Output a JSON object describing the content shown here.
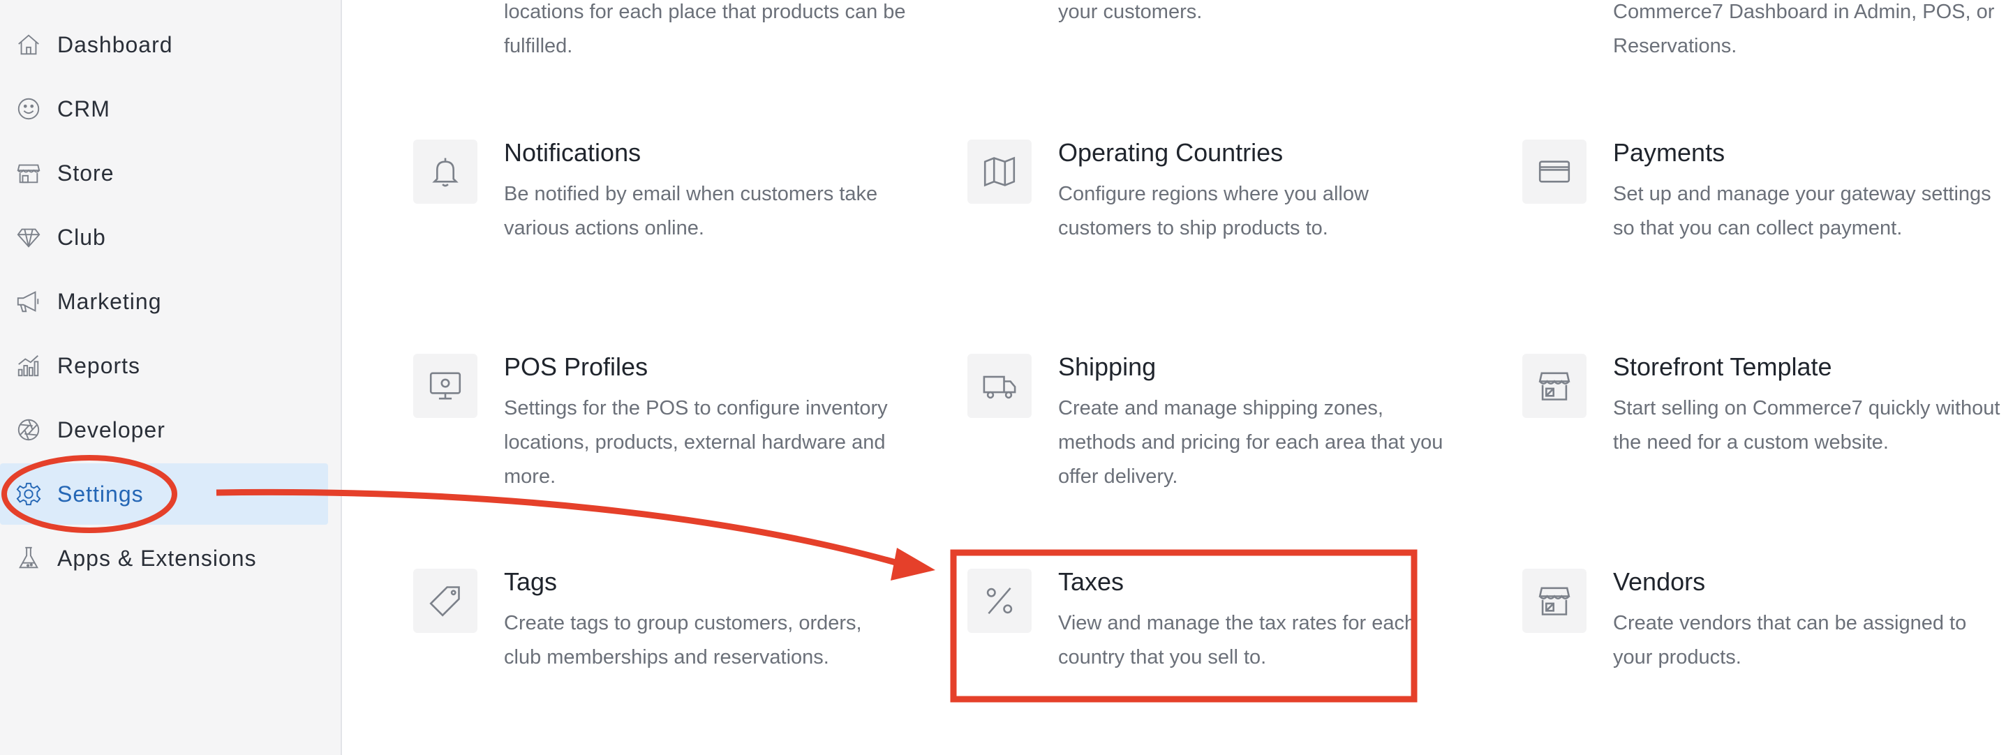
{
  "sidebar": {
    "items": [
      {
        "label": "Dashboard",
        "icon": "home-icon"
      },
      {
        "label": "CRM",
        "icon": "smiley-icon"
      },
      {
        "label": "Store",
        "icon": "storefront-icon"
      },
      {
        "label": "Club",
        "icon": "diamond-icon"
      },
      {
        "label": "Marketing",
        "icon": "megaphone-icon"
      },
      {
        "label": "Reports",
        "icon": "chart-icon"
      },
      {
        "label": "Developer",
        "icon": "aperture-icon"
      },
      {
        "label": "Settings",
        "icon": "gear-icon",
        "active": true
      },
      {
        "label": "Apps & Extensions",
        "icon": "flask-icon"
      }
    ]
  },
  "top_partial": [
    {
      "desc": "locations for each place that products can be fulfilled."
    },
    {
      "desc": "your customers."
    },
    {
      "desc": "Commerce7 Dashboard in Admin, POS, or Reservations."
    }
  ],
  "cards": [
    {
      "title": "Notifications",
      "desc": "Be notified by email when customers take various actions online.",
      "icon": "bell-icon"
    },
    {
      "title": "Operating Countries",
      "desc": "Configure regions where you allow customers to ship products to.",
      "icon": "map-icon"
    },
    {
      "title": "Payments",
      "desc": "Set up and manage your gateway settings so that you can collect payment.",
      "icon": "credit-card-icon"
    },
    {
      "title": "POS Profiles",
      "desc": "Settings for the POS to configure inventory locations, products, external hardware and more.",
      "icon": "monitor-icon"
    },
    {
      "title": "Shipping",
      "desc": "Create and manage shipping zones, methods and pricing for each area that you offer delivery.",
      "icon": "truck-icon"
    },
    {
      "title": "Storefront Template",
      "desc": "Start selling on Commerce7 quickly without the need for a custom website.",
      "icon": "storefront-icon"
    },
    {
      "title": "Tags",
      "desc": "Create tags to group customers, orders, club memberships and reservations.",
      "icon": "tag-icon"
    },
    {
      "title": "Taxes",
      "desc": "View and manage the tax rates for each country that you sell to.",
      "icon": "percent-icon"
    },
    {
      "title": "Vendors",
      "desc": "Create vendors that can be assigned to your products.",
      "icon": "storefront-icon"
    }
  ],
  "colors": {
    "annotation": "#e5402a",
    "active_bg": "#dcebfa",
    "active_text": "#2466b5"
  }
}
